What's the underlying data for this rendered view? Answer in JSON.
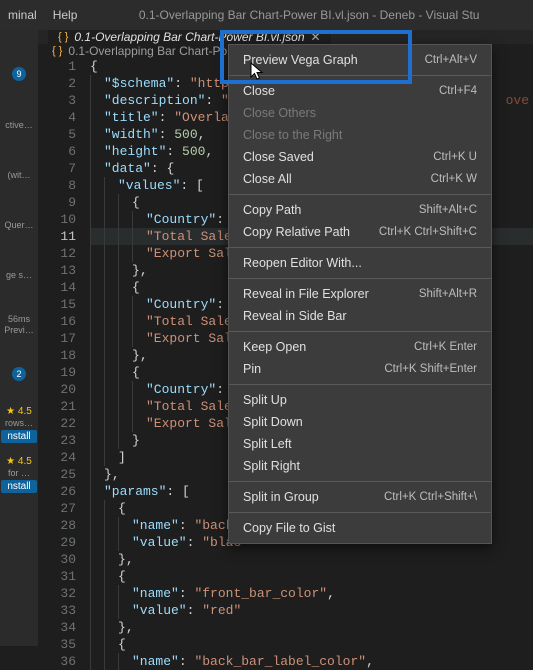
{
  "menubar": {
    "items": [
      "minal",
      "Help"
    ],
    "window_title": "0.1-Overlapping Bar Chart-Power BI.vl.json - Deneb - Visual Stu"
  },
  "tab": {
    "filename": "0.1-Overlapping Bar Chart-Power BI.vl.json"
  },
  "breadcrumb": {
    "path": "0.1-Overlapping Bar Chart-Po"
  },
  "activity": {
    "badge1": "9",
    "label_active": "ctive…",
    "label_wit": "(wit…",
    "label_quer": "Quer…",
    "label_ges": "ge s…",
    "badge2": "2",
    "stats1": "★ 4.5",
    "label_rows": "rows…",
    "install1": "nstall",
    "stats2": "★ 4.5",
    "label_for": "for …",
    "install2": "nstall",
    "ms_text": "56ms",
    "prev_text": "Previ…"
  },
  "context_menu": {
    "items": [
      {
        "label": "Preview Vega Graph",
        "sc": "Ctrl+Alt+V",
        "section": 0
      },
      {
        "label": "Close",
        "sc": "Ctrl+F4",
        "section": 1
      },
      {
        "label": "Close Others",
        "sc": "",
        "section": 1,
        "disabled": true
      },
      {
        "label": "Close to the Right",
        "sc": "",
        "section": 1,
        "disabled": true
      },
      {
        "label": "Close Saved",
        "sc": "Ctrl+K U",
        "section": 1
      },
      {
        "label": "Close All",
        "sc": "Ctrl+K W",
        "section": 1
      },
      {
        "label": "Copy Path",
        "sc": "Shift+Alt+C",
        "section": 2
      },
      {
        "label": "Copy Relative Path",
        "sc": "Ctrl+K Ctrl+Shift+C",
        "section": 2
      },
      {
        "label": "Reopen Editor With...",
        "sc": "",
        "section": 3
      },
      {
        "label": "Reveal in File Explorer",
        "sc": "Shift+Alt+R",
        "section": 4
      },
      {
        "label": "Reveal in Side Bar",
        "sc": "",
        "section": 4
      },
      {
        "label": "Keep Open",
        "sc": "Ctrl+K Enter",
        "section": 5
      },
      {
        "label": "Pin",
        "sc": "Ctrl+K Shift+Enter",
        "section": 5
      },
      {
        "label": "Split Up",
        "sc": "",
        "section": 6
      },
      {
        "label": "Split Down",
        "sc": "",
        "section": 6
      },
      {
        "label": "Split Left",
        "sc": "",
        "section": 6
      },
      {
        "label": "Split Right",
        "sc": "",
        "section": 6
      },
      {
        "label": "Split in Group",
        "sc": "Ctrl+K Ctrl+Shift+\\",
        "section": 7
      },
      {
        "label": "Copy File to Gist",
        "sc": "",
        "section": 8
      }
    ]
  },
  "code": {
    "lines": [
      "{",
      "  \"$schema\": \"https:",
      "  \"description\": \"A",
      "  \"title\": \"Overlapp",
      "  \"width\": 500,",
      "  \"height\": 500,",
      "  \"data\": {",
      "    \"values\": [",
      "      {",
      "        \"Country\": \"",
      "        \"Total Sales",
      "        \"Export Sale",
      "      },",
      "      {",
      "        \"Country\": \"",
      "        \"Total Sales",
      "        \"Export Sale",
      "      },",
      "      {",
      "        \"Country\": \"",
      "        \"Total Sales",
      "        \"Export Sale",
      "      }",
      "    ]",
      "  },",
      "  \"params\": [",
      "    {",
      "      \"name\": \"back_",
      "      \"value\": \"blac",
      "    },",
      "    {",
      "      \"name\": \"front_bar_color\",",
      "      \"value\": \"red\"",
      "    },",
      "    {",
      "      \"name\": \"back_bar_label_color\","
    ],
    "line_suffix_over": "ove",
    "highlighted_line": 11
  }
}
